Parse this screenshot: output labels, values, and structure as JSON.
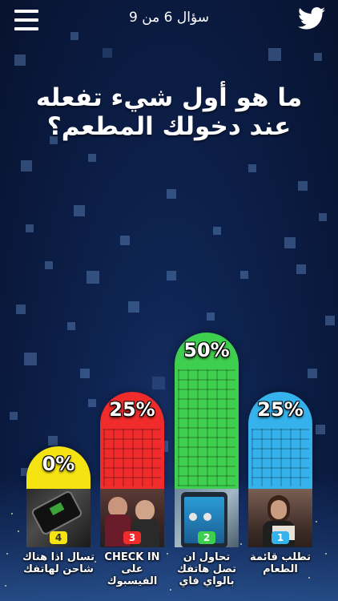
{
  "header": {
    "counter": "سؤال 6 من 9",
    "menu_icon": "hamburger-menu-icon",
    "twitter_icon": "twitter-bird-icon"
  },
  "question": "ما هو أول شيء تفعله عند دخولك المطعم؟",
  "colors": {
    "yellow": "#f5e411",
    "red": "#ef2b2b",
    "green": "#3fcf4f",
    "blue": "#35b2ec"
  },
  "options": [
    {
      "number": "4",
      "percent": "0%",
      "label": "تسال اذا هناك شاحن لهاتفك",
      "color": "#f5e411",
      "percent_value": 0,
      "image": "phone-charging-image"
    },
    {
      "number": "3",
      "percent": "25%",
      "label": "CHECK IN على الفيسبوك",
      "color": "#ef2b2b",
      "percent_value": 25,
      "image": "people-with-phone-image"
    },
    {
      "number": "2",
      "percent": "50%",
      "label": "تحاول ان تصل هاتفك بالواي فاي",
      "color": "#3fcf4f",
      "percent_value": 50,
      "image": "smartphone-wifi-image"
    },
    {
      "number": "1",
      "percent": "25%",
      "label": "تطلب قائمة الطعام",
      "color": "#35b2ec",
      "percent_value": 25,
      "image": "woman-reading-menu-image"
    }
  ]
}
